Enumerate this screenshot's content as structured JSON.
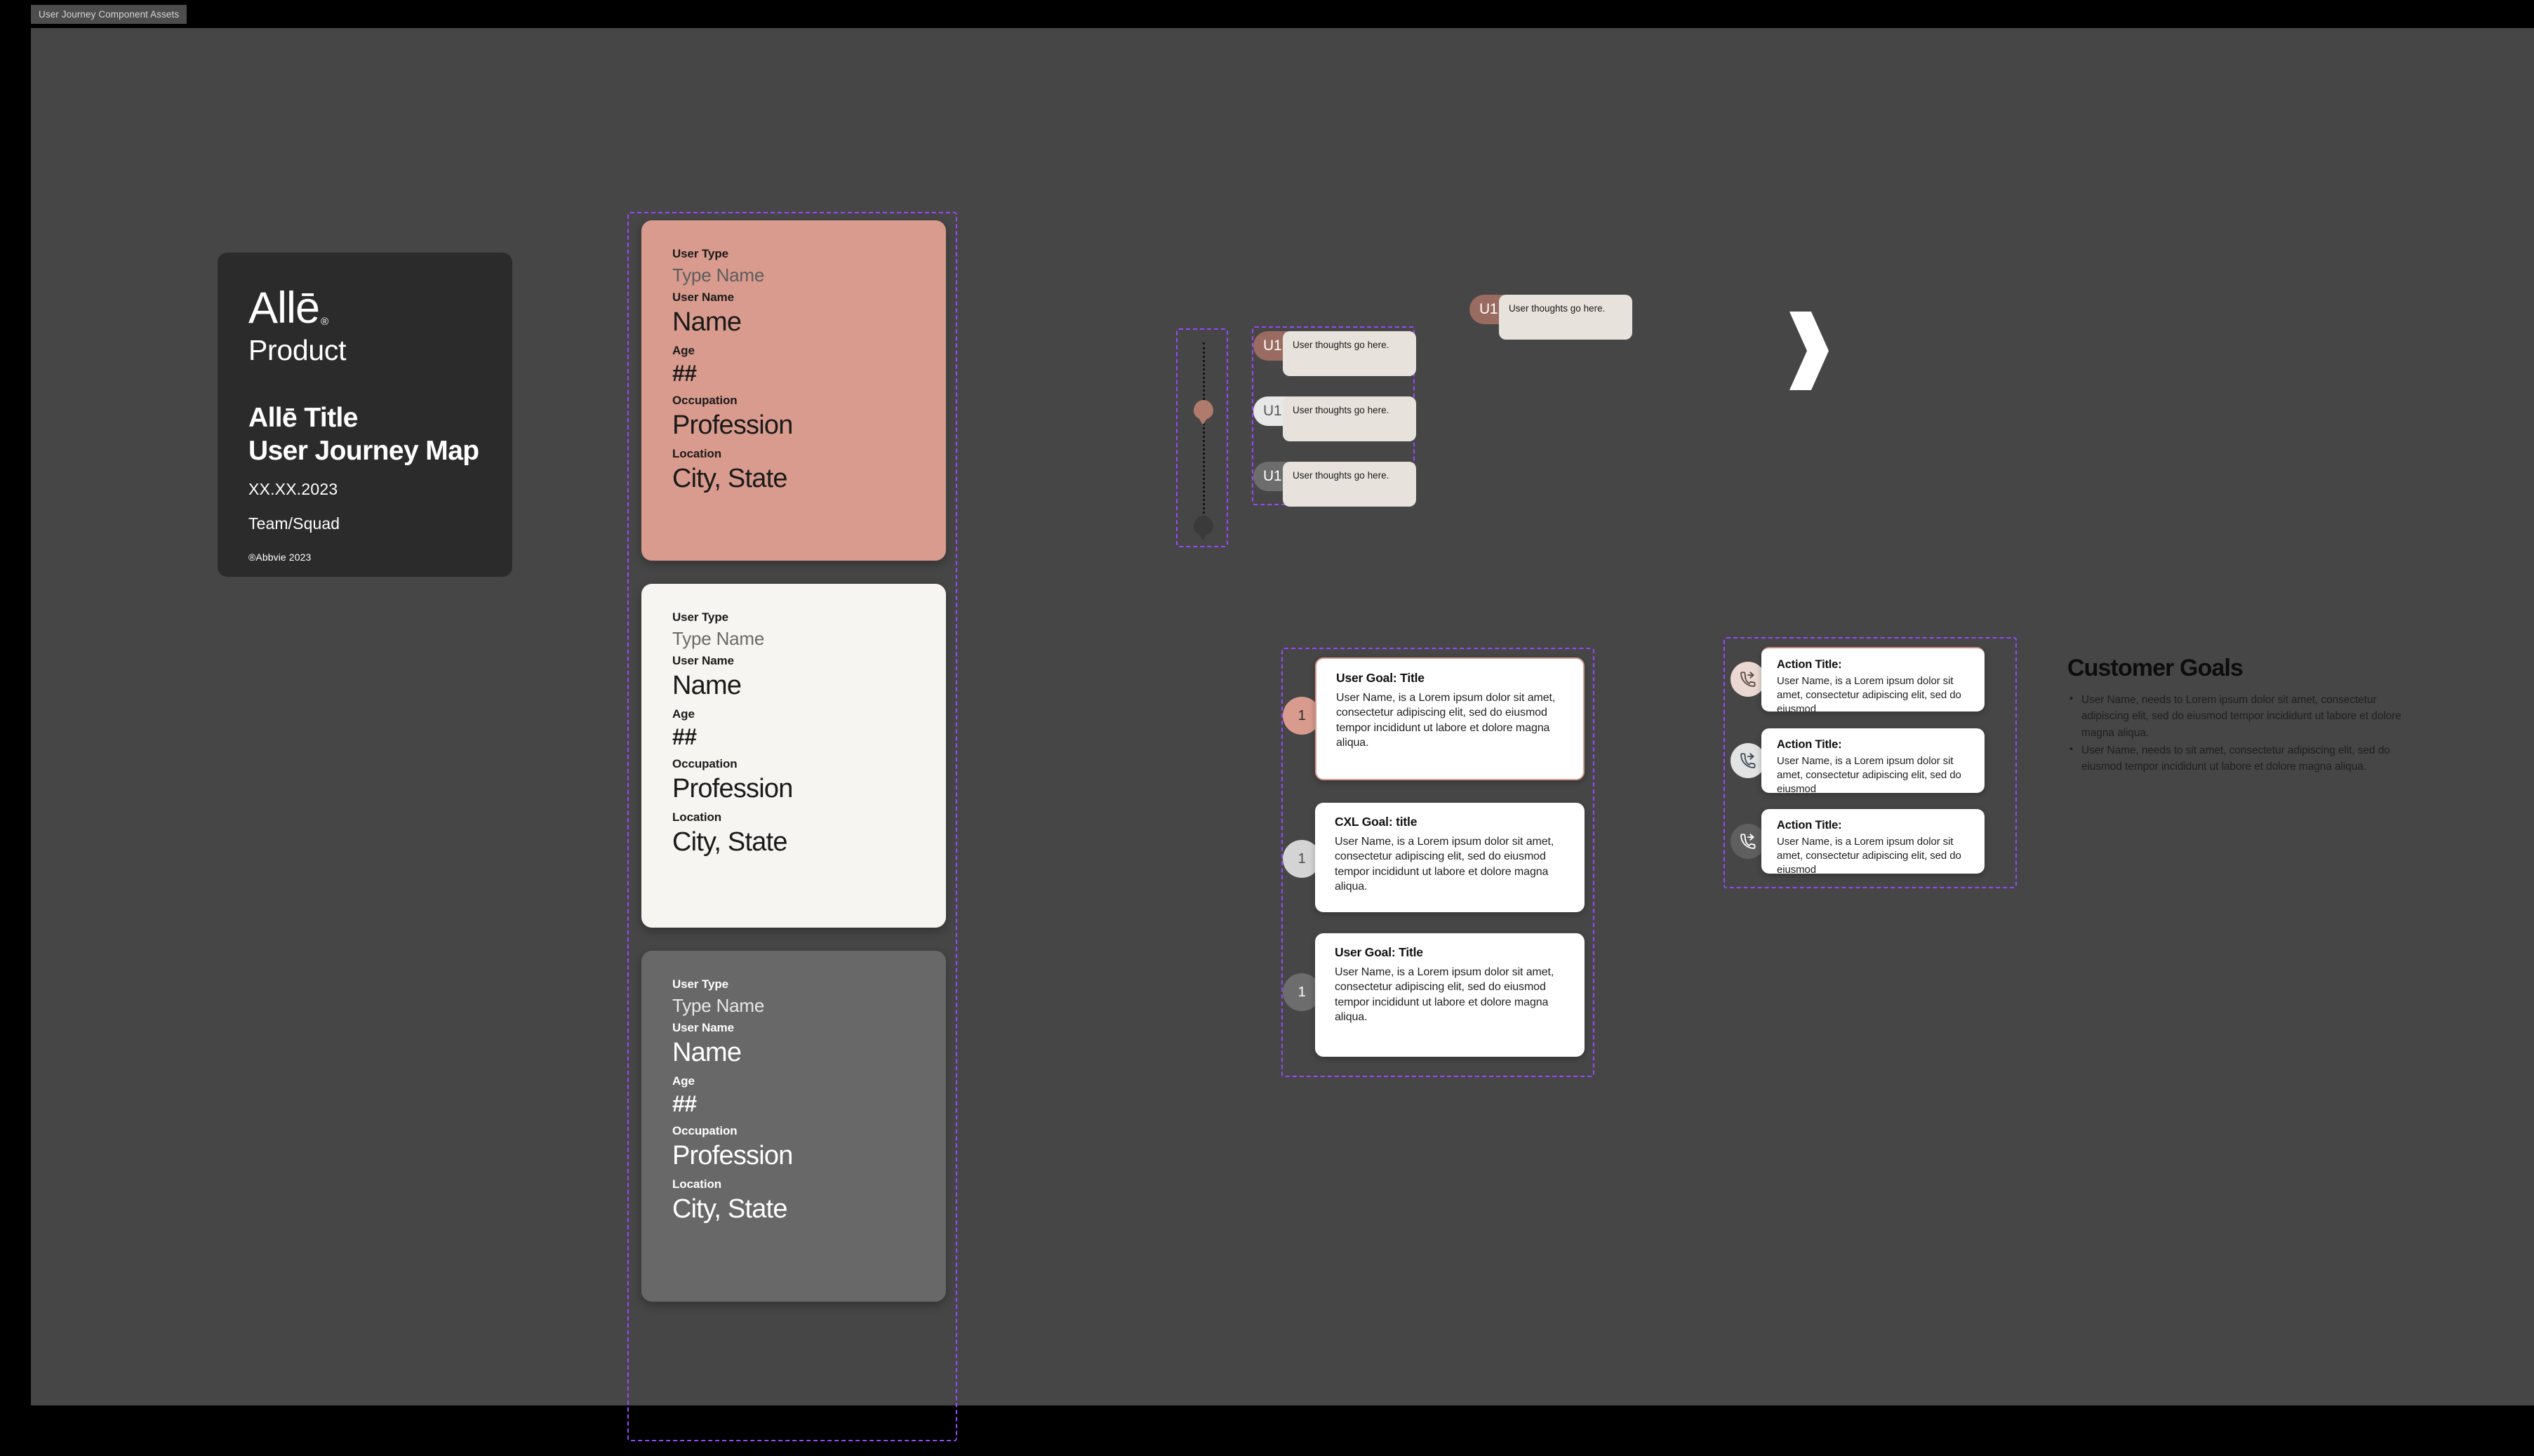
{
  "frame": {
    "label": "User Journey Component Assets",
    "canvas_bg": "#464646",
    "page_bg": "#000000",
    "selection_color": "#9747ff"
  },
  "title_card": {
    "brand": "Allē",
    "brand_mark": "®",
    "product": "Product",
    "doc_title_line1": "Allē Title",
    "doc_title_line2": "User Journey Map",
    "date": "XX.XX.2023",
    "team": "Team/Squad",
    "copyright": "®Abbvie 2023",
    "bg": "#2b2b2b"
  },
  "persona_labels": {
    "user_type": "User Type",
    "user_name": "User Name",
    "age": "Age",
    "occupation": "Occupation",
    "location": "Location"
  },
  "personas": [
    {
      "variant": "salmon",
      "bg": "#d99b8e",
      "type_value": "Type Name",
      "name_value": "Name",
      "age_value": "##",
      "occupation_value": "Profession",
      "location_value": "City, State"
    },
    {
      "variant": "light",
      "bg": "#f6f5f2",
      "type_value": "Type Name",
      "name_value": "Name",
      "age_value": "##",
      "occupation_value": "Profession",
      "location_value": "City, State"
    },
    {
      "variant": "gray",
      "bg": "#686868",
      "type_value": "Type Name",
      "name_value": "Name",
      "age_value": "##",
      "occupation_value": "Profession",
      "location_value": "City, State"
    }
  ],
  "pins": [
    {
      "name": "map-pin-salmon",
      "color": "#b07a6d"
    },
    {
      "name": "map-pin-dark",
      "color": "#3a3a3a"
    }
  ],
  "thoughts": [
    {
      "badge": "U1",
      "text": "User thoughts go here.",
      "badge_bg": "#9a6b60"
    },
    {
      "badge": "U1",
      "text": "User thoughts go here.",
      "badge_bg": "#e8e8e8"
    },
    {
      "badge": "U1",
      "text": "User thoughts go here.",
      "badge_bg": "#6d6d6d"
    }
  ],
  "featured_thought": {
    "badge": "U1",
    "text": "User thoughts go here.",
    "badge_bg": "#9a6b60"
  },
  "goals": [
    {
      "number": "1",
      "title": "User Goal: Title",
      "body": "User Name, is a Lorem ipsum dolor sit amet, consectetur adipiscing elit, sed do eiusmod tempor incididunt ut labore et dolore magna aliqua.",
      "accent": "#d99b8e"
    },
    {
      "number": "1",
      "title": "CXL Goal: title",
      "body": "User Name, is a Lorem ipsum dolor sit amet, consectetur adipiscing elit, sed do eiusmod tempor incididunt ut labore et dolore magna aliqua.",
      "accent": "#d4d4d4"
    },
    {
      "number": "1",
      "title": "User Goal: Title",
      "body": "User Name, is a Lorem ipsum dolor sit amet, consectetur adipiscing elit, sed do eiusmod tempor incididunt ut labore et dolore magna aliqua.",
      "accent": "#6d6d6d"
    }
  ],
  "actions": [
    {
      "icon": "phone-forwarded-icon",
      "title": "Action Title:",
      "body": "User Name, is a Lorem ipsum dolor sit amet, consectetur adipiscing elit, sed do eiusmod",
      "icon_bg": "#ebd8d2"
    },
    {
      "icon": "phone-forwarded-icon",
      "title": "Action Title:",
      "body": "User Name, is a Lorem ipsum dolor sit amet, consectetur adipiscing elit, sed do eiusmod",
      "icon_bg": "#e3e3e3"
    },
    {
      "icon": "phone-forwarded-icon",
      "title": "Action Title:",
      "body": "User Name, is a Lorem ipsum dolor sit amet, consectetur adipiscing elit, sed do eiusmod",
      "icon_bg": "#5f5f5f"
    }
  ],
  "customer_goals": {
    "heading": "Customer Goals",
    "items": [
      "User Name, needs to Lorem ipsum dolor sit amet, consectetur adipiscing elit, sed do eiusmod tempor incididunt ut labore et dolore magna aliqua.",
      "User Name, needs to sit amet, consectetur adipiscing elit, sed do eiusmod tempor incididunt ut labore et dolore magna aliqua."
    ]
  }
}
